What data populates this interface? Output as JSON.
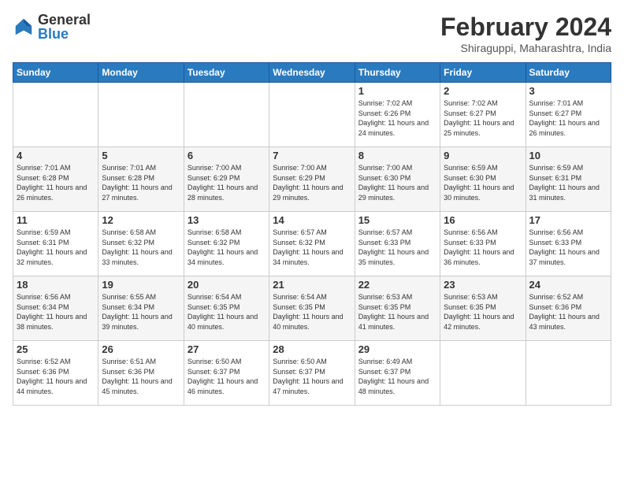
{
  "logo": {
    "general": "General",
    "blue": "Blue"
  },
  "title": "February 2024",
  "location": "Shiraguppi, Maharashtra, India",
  "days_of_week": [
    "Sunday",
    "Monday",
    "Tuesday",
    "Wednesday",
    "Thursday",
    "Friday",
    "Saturday"
  ],
  "weeks": [
    [
      {
        "day": "",
        "info": ""
      },
      {
        "day": "",
        "info": ""
      },
      {
        "day": "",
        "info": ""
      },
      {
        "day": "",
        "info": ""
      },
      {
        "day": "1",
        "sunrise": "7:02 AM",
        "sunset": "6:26 PM",
        "daylight": "11 hours and 24 minutes."
      },
      {
        "day": "2",
        "sunrise": "7:02 AM",
        "sunset": "6:27 PM",
        "daylight": "11 hours and 25 minutes."
      },
      {
        "day": "3",
        "sunrise": "7:01 AM",
        "sunset": "6:27 PM",
        "daylight": "11 hours and 26 minutes."
      }
    ],
    [
      {
        "day": "4",
        "sunrise": "7:01 AM",
        "sunset": "6:28 PM",
        "daylight": "11 hours and 26 minutes."
      },
      {
        "day": "5",
        "sunrise": "7:01 AM",
        "sunset": "6:28 PM",
        "daylight": "11 hours and 27 minutes."
      },
      {
        "day": "6",
        "sunrise": "7:00 AM",
        "sunset": "6:29 PM",
        "daylight": "11 hours and 28 minutes."
      },
      {
        "day": "7",
        "sunrise": "7:00 AM",
        "sunset": "6:29 PM",
        "daylight": "11 hours and 29 minutes."
      },
      {
        "day": "8",
        "sunrise": "7:00 AM",
        "sunset": "6:30 PM",
        "daylight": "11 hours and 29 minutes."
      },
      {
        "day": "9",
        "sunrise": "6:59 AM",
        "sunset": "6:30 PM",
        "daylight": "11 hours and 30 minutes."
      },
      {
        "day": "10",
        "sunrise": "6:59 AM",
        "sunset": "6:31 PM",
        "daylight": "11 hours and 31 minutes."
      }
    ],
    [
      {
        "day": "11",
        "sunrise": "6:59 AM",
        "sunset": "6:31 PM",
        "daylight": "11 hours and 32 minutes."
      },
      {
        "day": "12",
        "sunrise": "6:58 AM",
        "sunset": "6:32 PM",
        "daylight": "11 hours and 33 minutes."
      },
      {
        "day": "13",
        "sunrise": "6:58 AM",
        "sunset": "6:32 PM",
        "daylight": "11 hours and 34 minutes."
      },
      {
        "day": "14",
        "sunrise": "6:57 AM",
        "sunset": "6:32 PM",
        "daylight": "11 hours and 34 minutes."
      },
      {
        "day": "15",
        "sunrise": "6:57 AM",
        "sunset": "6:33 PM",
        "daylight": "11 hours and 35 minutes."
      },
      {
        "day": "16",
        "sunrise": "6:56 AM",
        "sunset": "6:33 PM",
        "daylight": "11 hours and 36 minutes."
      },
      {
        "day": "17",
        "sunrise": "6:56 AM",
        "sunset": "6:33 PM",
        "daylight": "11 hours and 37 minutes."
      }
    ],
    [
      {
        "day": "18",
        "sunrise": "6:56 AM",
        "sunset": "6:34 PM",
        "daylight": "11 hours and 38 minutes."
      },
      {
        "day": "19",
        "sunrise": "6:55 AM",
        "sunset": "6:34 PM",
        "daylight": "11 hours and 39 minutes."
      },
      {
        "day": "20",
        "sunrise": "6:54 AM",
        "sunset": "6:35 PM",
        "daylight": "11 hours and 40 minutes."
      },
      {
        "day": "21",
        "sunrise": "6:54 AM",
        "sunset": "6:35 PM",
        "daylight": "11 hours and 40 minutes."
      },
      {
        "day": "22",
        "sunrise": "6:53 AM",
        "sunset": "6:35 PM",
        "daylight": "11 hours and 41 minutes."
      },
      {
        "day": "23",
        "sunrise": "6:53 AM",
        "sunset": "6:35 PM",
        "daylight": "11 hours and 42 minutes."
      },
      {
        "day": "24",
        "sunrise": "6:52 AM",
        "sunset": "6:36 PM",
        "daylight": "11 hours and 43 minutes."
      }
    ],
    [
      {
        "day": "25",
        "sunrise": "6:52 AM",
        "sunset": "6:36 PM",
        "daylight": "11 hours and 44 minutes."
      },
      {
        "day": "26",
        "sunrise": "6:51 AM",
        "sunset": "6:36 PM",
        "daylight": "11 hours and 45 minutes."
      },
      {
        "day": "27",
        "sunrise": "6:50 AM",
        "sunset": "6:37 PM",
        "daylight": "11 hours and 46 minutes."
      },
      {
        "day": "28",
        "sunrise": "6:50 AM",
        "sunset": "6:37 PM",
        "daylight": "11 hours and 47 minutes."
      },
      {
        "day": "29",
        "sunrise": "6:49 AM",
        "sunset": "6:37 PM",
        "daylight": "11 hours and 48 minutes."
      },
      {
        "day": "",
        "info": ""
      },
      {
        "day": "",
        "info": ""
      }
    ]
  ]
}
